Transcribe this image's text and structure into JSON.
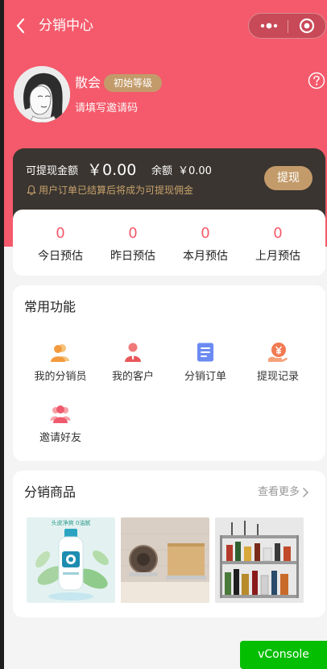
{
  "nav": {
    "title": "分销中心",
    "back_icon": "chevron-left-icon",
    "more_icon": "more-dots-icon",
    "close_icon": "mini-program-close-icon"
  },
  "profile": {
    "name": "散会",
    "level": "初始等级",
    "invite_prompt": "请填写邀请码",
    "help_icon": "question-circle-icon",
    "avatar_icon": "user-avatar-illustration"
  },
  "balance": {
    "withdrawable_label": "可提现金额",
    "withdrawable_amount": "￥0.00",
    "balance_label": "余额",
    "balance_amount": "￥0.00",
    "note": "用户订单已结算后将成为可提现佣金",
    "withdraw_button": "提现"
  },
  "stats": [
    {
      "value": "0",
      "label": "今日预估"
    },
    {
      "value": "0",
      "label": "昨日预估"
    },
    {
      "value": "0",
      "label": "本月预估"
    },
    {
      "value": "0",
      "label": "上月预估"
    }
  ],
  "functions": {
    "title": "常用功能",
    "items": [
      {
        "label": "我的分销员",
        "icon": "distributor-group-icon"
      },
      {
        "label": "我的客户",
        "icon": "customer-icon"
      },
      {
        "label": "分销订单",
        "icon": "order-list-icon"
      },
      {
        "label": "提现记录",
        "icon": "withdraw-record-icon"
      },
      {
        "label": "邀请好友",
        "icon": "invite-friends-icon"
      }
    ]
  },
  "products": {
    "title": "分销商品",
    "see_more": "查看更多",
    "banner_text": "头皮净爽 0油腻",
    "items": [
      {
        "image": "shampoo-bottle-image"
      },
      {
        "image": "wall-cutting-board-rack-image"
      },
      {
        "image": "kitchen-spice-rack-image"
      }
    ]
  },
  "colors": {
    "primary": "#f45a6b",
    "card_dark": "#3a3531",
    "gold": "#c39b6a",
    "vconsole": "#04be02"
  },
  "vconsole": {
    "label": "vConsole"
  }
}
